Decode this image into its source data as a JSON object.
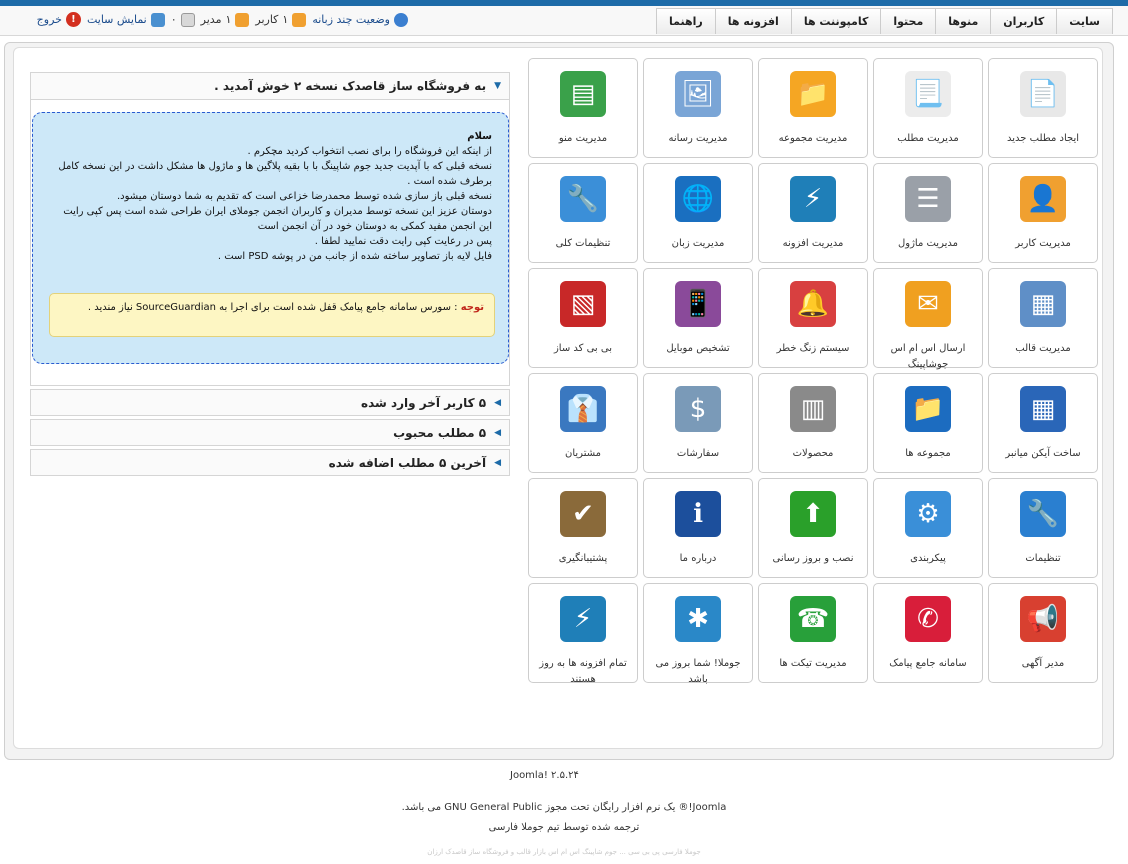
{
  "menu": [
    "سایت",
    "کاربران",
    "منوها",
    "محتوا",
    "کامپوننت ها",
    "افزونه ها",
    "راهنما"
  ],
  "status": {
    "multilang": "وضعیت چند زبانه",
    "users_count": "۱",
    "users_label": "کاربر",
    "admins_count": "۱",
    "admins_label": "مدیر",
    "messages_count": "۰",
    "view_site": "نمایش سایت",
    "logout": "خروج"
  },
  "tiles": [
    {
      "label": "ایجاد مطلب جدید",
      "icon": "article-add-icon",
      "color": "#e8e8e8",
      "glyph": "📄"
    },
    {
      "label": "مدیریت مطلب",
      "icon": "article-icon",
      "color": "#ececec",
      "glyph": "📃"
    },
    {
      "label": "مدیریت مجموعه",
      "icon": "folder-icon",
      "color": "#f5a623",
      "glyph": "📁"
    },
    {
      "label": "مدیریت رسانه",
      "icon": "media-icon",
      "color": "#7aa5d6",
      "glyph": "🖼"
    },
    {
      "label": "مدیریت منو",
      "icon": "menu-manager-icon",
      "color": "#3aa14a",
      "glyph": "▤"
    },
    {
      "label": "مدیریت کاربر",
      "icon": "user-icon",
      "color": "#f0a030",
      "glyph": "👤"
    },
    {
      "label": "مدیریت ماژول",
      "icon": "module-icon",
      "color": "#9aa0a8",
      "glyph": "☰"
    },
    {
      "label": "مدیریت افزونه",
      "icon": "plugin-icon",
      "color": "#1f7fb8",
      "glyph": "⚡"
    },
    {
      "label": "مدیریت زبان",
      "icon": "globe-icon",
      "color": "#1a6fc0",
      "glyph": "🌐"
    },
    {
      "label": "تنظیمات کلی",
      "icon": "tools-icon",
      "color": "#3b8fd8",
      "glyph": "🔧"
    },
    {
      "label": "مدیریت قالب",
      "icon": "template-icon",
      "color": "#5f8fc7",
      "glyph": "▦"
    },
    {
      "label": "ارسال اس ام اس جوشاپینگ",
      "icon": "inbox-icon",
      "color": "#f0a020",
      "glyph": "✉"
    },
    {
      "label": "سیستم زنگ خطر",
      "icon": "alarm-icon",
      "color": "#d84040",
      "glyph": "🔔"
    },
    {
      "label": "تشخیص موبایل",
      "icon": "mobile-icon",
      "color": "#8a4a9a",
      "glyph": "📱"
    },
    {
      "label": "بی بی کد ساز",
      "icon": "bbcode-icon",
      "color": "#c82828",
      "glyph": "▧"
    },
    {
      "label": "ساخت آیکن میانبر",
      "icon": "shortcut-icon",
      "color": "#2a66b8",
      "glyph": "▦"
    },
    {
      "label": "مجموعه ها",
      "icon": "category-folder-icon",
      "color": "#1c6cc0",
      "glyph": "📁"
    },
    {
      "label": "محصولات",
      "icon": "product-icon",
      "color": "#8a8a8a",
      "glyph": "▥"
    },
    {
      "label": "سفارشات",
      "icon": "dollar-icon",
      "color": "#7a9ab8",
      "glyph": "$"
    },
    {
      "label": "مشتریان",
      "icon": "customer-icon",
      "color": "#3a78c0",
      "glyph": "👔"
    },
    {
      "label": "تنظیمات",
      "icon": "wrench-icon",
      "color": "#2a7fd0",
      "glyph": "🔧"
    },
    {
      "label": "پیکربندی",
      "icon": "gear-icon",
      "color": "#3a8fd8",
      "glyph": "⚙"
    },
    {
      "label": "نصب و بروز رسانی",
      "icon": "upload-icon",
      "color": "#2aa02a",
      "glyph": "⬆"
    },
    {
      "label": "درباره ما",
      "icon": "info-icon",
      "color": "#1c4f9c",
      "glyph": "ℹ"
    },
    {
      "label": "پشتیبانگیری",
      "icon": "backup-icon",
      "color": "#8a6a3a",
      "glyph": "✔"
    },
    {
      "label": "مدیر آگهی",
      "icon": "megaphone-icon",
      "color": "#d84030",
      "glyph": "📢"
    },
    {
      "label": "سامانه جامع پیامک",
      "icon": "sms-icon",
      "color": "#d81e3a",
      "glyph": "✆"
    },
    {
      "label": "مدیریت تیکت ها",
      "icon": "ticket-icon",
      "color": "#28a03a",
      "glyph": "☎"
    },
    {
      "label": "جوملا! شما بروز می باشد",
      "icon": "joomla-update-icon",
      "color": "#2a88c8",
      "glyph": "✱"
    },
    {
      "label": "تمام افزونه ها به روز هستند",
      "icon": "plugins-updated-icon",
      "color": "#1f7fb8",
      "glyph": "⚡"
    }
  ],
  "welcome": {
    "title": "به فروشگاه ساز قاصدک نسخه ۲ خوش آمدید .",
    "lines": [
      "سلام",
      "از اینکه این فروشگاه را برای نصب انتخواب کردید مچکرم .",
      "نسخه قبلی که با آپدیت جدید جوم شاپینگ با با بقیه پلاگین ها و ماژول ها مشکل داشت در این نسخه کامل برطرف شده است .",
      "نسخه قبلی باز سازی شده توسط محمدرضا خزاعی است که تقدیم به شما دوستان میشود.",
      "دوستان عزیز این نسخه توسط مدیران و کاربران انجمن جوملای ایران طراحی شده است پس کپی رایت این انجمن مفید کمکی به دوستان خود در آن انجمن است",
      "پس در رعایت کپی رایت دقت نمایید لطفا .",
      "فایل لایه باز تصاویر ساخته شده از جانب من در پوشه PSD است ."
    ],
    "note_label": "توجه",
    "note_text": ": سورس سامانه جامع پیامک قفل شده است برای اجرا به SourceGuardian نیاز مندید ."
  },
  "accordions": [
    "۵ کاربر آخر وارد شده",
    "۵ مطلب محبوب",
    "آخرین ۵ مطلب اضافه شده"
  ],
  "footer": {
    "version": "Joomla! ۲.۵.۲۴",
    "license": "Joomla!® یک نرم افزار رایگان تحت مجوز GNU General Public می باشد.",
    "translation": "ترجمه شده توسط تیم جوملا فارسی",
    "faint": "جوملا فارسی پی بی سی ... جوم شاپینگ اس ام اس بازار قالب و فروشگاه ساز قاصدک ارزان"
  }
}
